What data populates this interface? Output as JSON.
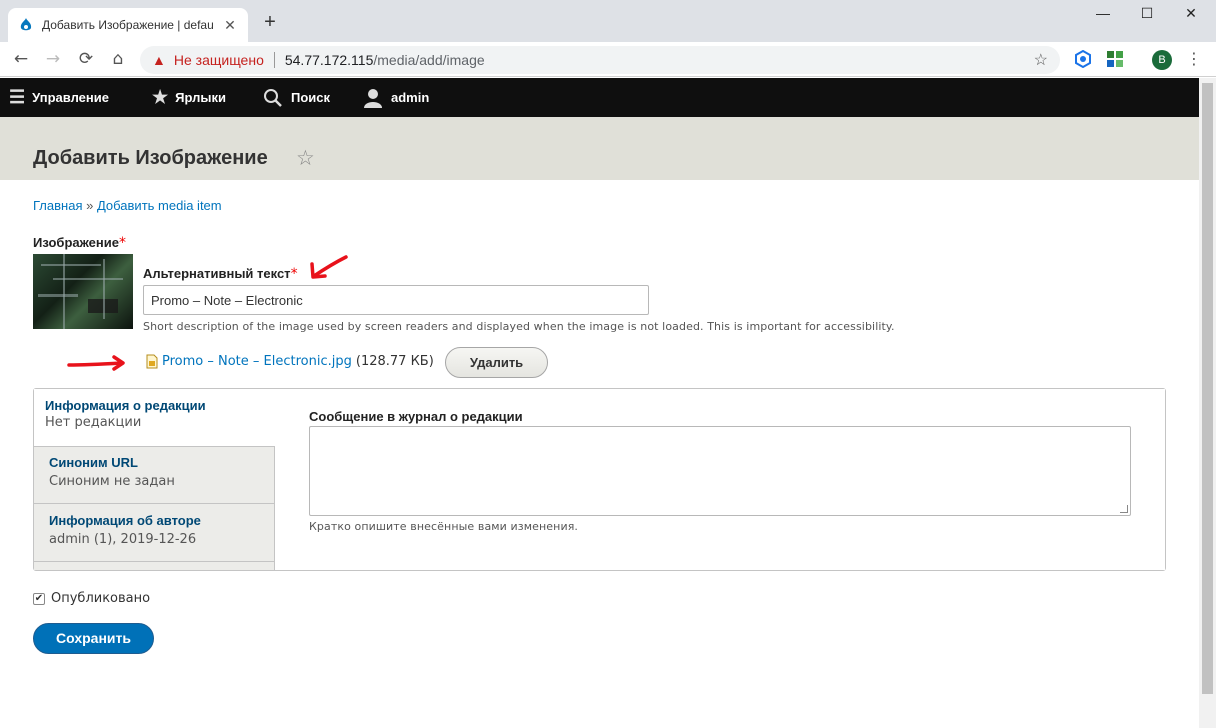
{
  "browser": {
    "tab_title": "Добавить Изображение | defau",
    "new_tab": "+",
    "window": {
      "minimize": "—",
      "maximize": "☐",
      "close": "✕"
    },
    "nav": {
      "back": "←",
      "forward": "→",
      "reload": "⟳",
      "home": "⌂"
    },
    "address": {
      "security": "Не защищено",
      "host": "54.77.172.115",
      "path": "/media/add/image"
    },
    "profile_initial": "B"
  },
  "admin_toolbar": {
    "manage": "Управление",
    "shortcuts": "Ярлыки",
    "search": "Поиск",
    "user": "admin"
  },
  "page": {
    "title": "Добавить Изображение",
    "breadcrumb": {
      "home": "Главная",
      "sep": "»",
      "add": "Добавить media item"
    }
  },
  "form": {
    "image_label": "Изображение",
    "required_mark": "*",
    "alt_label": "Альтернативный текст",
    "alt_value": "Promo – Note – Electronic",
    "alt_description": "Short description of the image used by screen readers and displayed when the image is not loaded. This is important for accessibility.",
    "file_name": "Promo – Note – Electronic.jpg",
    "file_size": "(128.77 КБ)",
    "remove_button": "Удалить",
    "vertical_tabs": [
      {
        "title": "Информация о редакции",
        "summary": "Нет редакции"
      },
      {
        "title": "Синоним URL",
        "summary": "Синоним не задан"
      },
      {
        "title": "Информация об авторе",
        "summary": "admin (1), 2019-12-26"
      }
    ],
    "revision_label": "Сообщение в журнал о редакции",
    "revision_hint": "Кратко опишите внесённые вами изменения.",
    "published_label": "Опубликовано",
    "published_checked": true,
    "save_button": "Сохранить"
  },
  "colors": {
    "link": "#0074bd",
    "save_bg": "#0071b8",
    "toolbar_bg": "#0f0f0f",
    "annotation_red": "#e8121b"
  }
}
